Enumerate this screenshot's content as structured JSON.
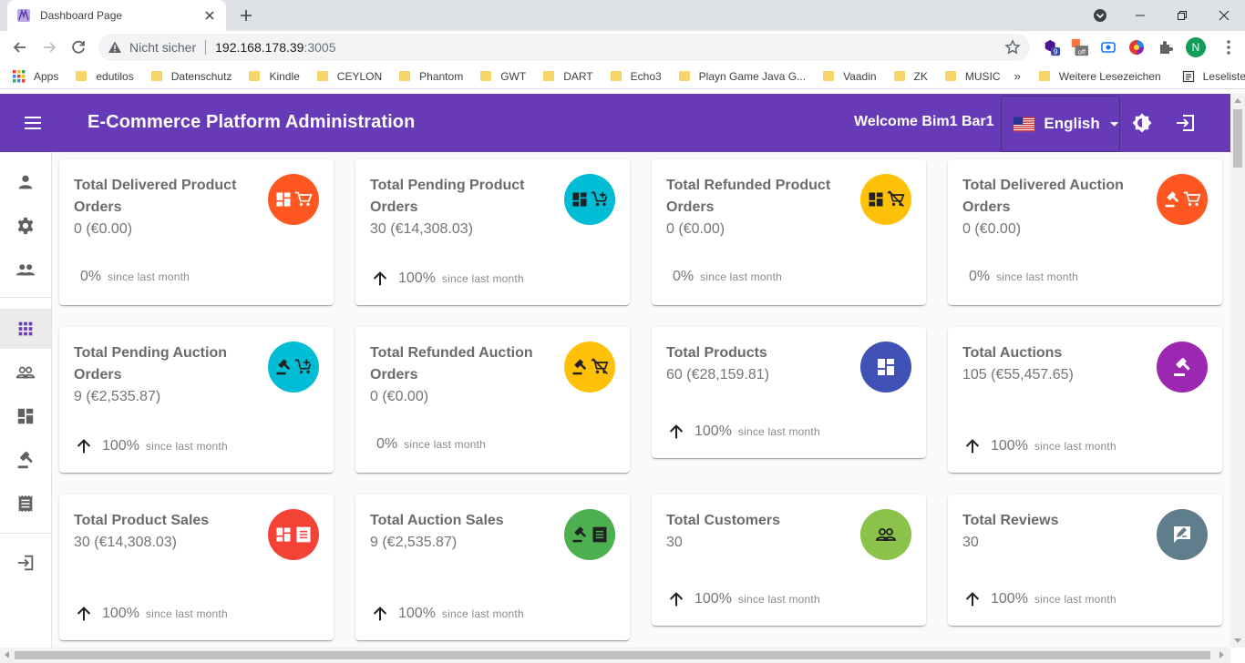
{
  "browser": {
    "tab_title": "Dashboard Page",
    "address": {
      "security": "Nicht sicher",
      "host": "192.168.178.39",
      "port": ":3005"
    },
    "profile_initial": "N",
    "extension_badge_count": "9",
    "extension_off_label": "off",
    "bookmarks": [
      {
        "label": "Apps",
        "kind": "apps"
      },
      {
        "label": "edutilos",
        "kind": "folder"
      },
      {
        "label": "Datenschutz",
        "kind": "folder"
      },
      {
        "label": "Kindle",
        "kind": "folder"
      },
      {
        "label": "CEYLON",
        "kind": "folder"
      },
      {
        "label": "Phantom",
        "kind": "folder"
      },
      {
        "label": "GWT",
        "kind": "folder"
      },
      {
        "label": "DART",
        "kind": "folder"
      },
      {
        "label": "Echo3",
        "kind": "folder"
      },
      {
        "label": "Playn Game Java G...",
        "kind": "folder"
      },
      {
        "label": "Vaadin",
        "kind": "folder"
      },
      {
        "label": "ZK",
        "kind": "folder"
      },
      {
        "label": "MUSIC",
        "kind": "folder"
      }
    ],
    "bookmarks_more": "»",
    "other_bookmarks": "Weitere Lesezeichen",
    "reading_list": "Leseliste"
  },
  "app": {
    "title": "E-Commerce Platform Administration",
    "welcome": "Welcome Bim1 Bar1",
    "language": "English",
    "colors": {
      "appbar": "#673ab7"
    }
  },
  "sidebar": [
    {
      "name": "sidebar-item-profile",
      "icon": "person-icon",
      "active": false
    },
    {
      "name": "sidebar-item-settings",
      "icon": "gear-icon",
      "active": false
    },
    {
      "name": "sidebar-item-users",
      "icon": "people-icon",
      "active": false
    },
    {
      "name": "sidebar-item-dashboard",
      "icon": "apps-grid-icon",
      "active": true
    },
    {
      "name": "sidebar-item-customers",
      "icon": "people-outline-icon",
      "active": false
    },
    {
      "name": "sidebar-item-products",
      "icon": "dashboard-icon",
      "active": false
    },
    {
      "name": "sidebar-item-auctions",
      "icon": "gavel-icon",
      "active": false
    },
    {
      "name": "sidebar-item-sales",
      "icon": "receipt-icon",
      "active": false
    },
    {
      "name": "sidebar-item-logout",
      "icon": "login-icon",
      "active": false
    }
  ],
  "cards": [
    {
      "title": "Total Delivered Product Orders",
      "value": "0 (€0.00)",
      "trend": "0%",
      "arrow": false,
      "since": "since last month",
      "color": "#ff5722",
      "icon": "product-cart-icon"
    },
    {
      "title": "Total Pending Product Orders",
      "value": "30 (€14,308.03)",
      "trend": "100%",
      "arrow": true,
      "since": "since last month",
      "color": "#00bcd4",
      "icon": "product-cart-add-icon"
    },
    {
      "title": "Total Refunded Product Orders",
      "value": "0 (€0.00)",
      "trend": "0%",
      "arrow": false,
      "since": "since last month",
      "color": "#ffc107",
      "icon": "product-cart-off-icon"
    },
    {
      "title": "Total Delivered Auction Orders",
      "value": "0 (€0.00)",
      "trend": "0%",
      "arrow": false,
      "since": "since last month",
      "color": "#ff5722",
      "icon": "gavel-cart-icon"
    },
    {
      "title": "Total Pending Auction Orders",
      "value": "9 (€2,535.87)",
      "trend": "100%",
      "arrow": true,
      "since": "since last month",
      "color": "#00bcd4",
      "icon": "gavel-cart-add-icon"
    },
    {
      "title": "Total Refunded Auction Orders",
      "value": "0 (€0.00)",
      "trend": "0%",
      "arrow": false,
      "since": "since last month",
      "color": "#ffc107",
      "icon": "gavel-cart-off-icon"
    },
    {
      "title": "Total Products",
      "value": "60 (€28,159.81)",
      "trend": "100%",
      "arrow": true,
      "since": "since last month",
      "color": "#3f51b5",
      "icon": "product-icon"
    },
    {
      "title": "Total Auctions",
      "value": "105 (€55,457.65)",
      "trend": "100%",
      "arrow": true,
      "since": "since last month",
      "color": "#9c27b0",
      "icon": "gavel-icon"
    },
    {
      "title": "Total Product Sales",
      "value": "30 (€14,308.03)",
      "trend": "100%",
      "arrow": true,
      "since": "since last month",
      "color": "#f44336",
      "icon": "product-receipt-icon"
    },
    {
      "title": "Total Auction Sales",
      "value": "9 (€2,535.87)",
      "trend": "100%",
      "arrow": true,
      "since": "since last month",
      "color": "#4caf50",
      "icon": "gavel-receipt-icon"
    },
    {
      "title": "Total Customers",
      "value": "30",
      "trend": "100%",
      "arrow": true,
      "since": "since last month",
      "color": "#8bc34a",
      "icon": "customers-icon"
    },
    {
      "title": "Total Reviews",
      "value": "30",
      "trend": "100%",
      "arrow": true,
      "since": "since last month",
      "color": "#607d8b",
      "icon": "review-icon"
    }
  ]
}
